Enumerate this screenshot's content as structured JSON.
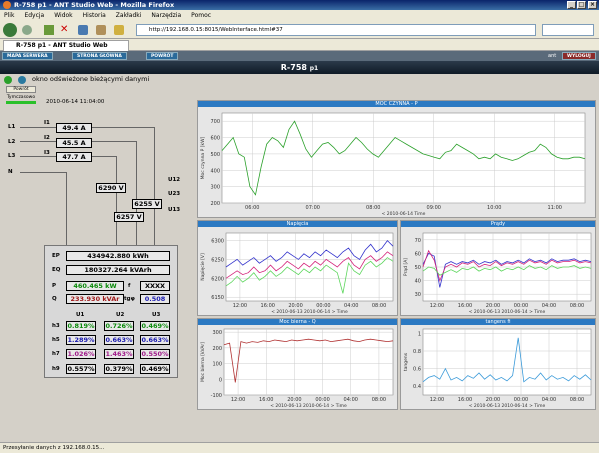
{
  "browser": {
    "title": "R-758 p1 - ANT Studio Web - Mozilla Firefox",
    "menu": [
      "Plik",
      "Edycja",
      "Widok",
      "Historia",
      "Zakładki",
      "Narzędzia",
      "Pomoc"
    ],
    "url": "http://192.168.0.15:8015/WebInterface.html#37",
    "tab_label": "R-758 p1 - ANT Studio Web",
    "status": "Przesyłanie danych z 192.168.0.15..."
  },
  "app": {
    "toolbar": [
      "MAPA SERWERA",
      "STRONA GŁÓWNA",
      "POWRÓT"
    ],
    "right_button": "WYLOGUJ",
    "user": "ant",
    "title_main": "R-758",
    "title_sub": "p1",
    "status_message": "okno odświeżone bieżącymi danymi",
    "btn_refresh": "Powrót",
    "btn_timeline": "Tymczasowo",
    "timestamp": "2010-06-14 11:04:00"
  },
  "panel": {
    "phases": [
      {
        "label": "L1",
        "sub": "I1",
        "value": "49.4 A"
      },
      {
        "label": "L2",
        "sub": "I2",
        "value": "45.5 A"
      },
      {
        "label": "L3",
        "sub": "I3",
        "value": "47.7 A"
      },
      {
        "label": "N"
      }
    ],
    "voltages": [
      {
        "label": "U12",
        "value": "6290 V"
      },
      {
        "label": "U23",
        "value": "6255 V"
      },
      {
        "label": "U13",
        "value": "6257 V"
      }
    ],
    "ep_label": "EP",
    "ep": "434942.880 kWh",
    "eq_label": "EQ",
    "eq": "180327.264 kVArh",
    "p_label": "P",
    "p": "460.465 kW",
    "f_label": "f",
    "f": "XXXX",
    "q_label": "Q",
    "q": "233.930 kVAr",
    "tgphi_label": "tgφ",
    "tgphi": "0.508",
    "harm_headers": [
      "U1",
      "U2",
      "U3"
    ],
    "harm_rows": [
      {
        "label": "h3",
        "values": [
          "0.819%",
          "0.726%",
          "0.469%"
        ],
        "color": "#0a8a0a"
      },
      {
        "label": "h5",
        "values": [
          "1.289%",
          "0.663%",
          "0.663%"
        ],
        "color": "#1a1ab0"
      },
      {
        "label": "h7",
        "values": [
          "1.026%",
          "1.463%",
          "0.550%"
        ],
        "color": "#a01a8a"
      },
      {
        "label": "h9",
        "values": [
          "0.557%",
          "0.379%",
          "0.469%"
        ],
        "color": "#000000"
      }
    ]
  },
  "chart_data": [
    {
      "type": "line",
      "title": "MOC CZYNNA - P",
      "ylabel": "Moc czynna P [kW]",
      "xlabel": "Time",
      "xnote": "< 2010-06-14",
      "x_ticks": [
        "06:00",
        "07:00",
        "08:00",
        "09:00",
        "10:00",
        "11:00"
      ],
      "y_ticks": [
        200,
        300,
        400,
        500,
        600,
        700
      ],
      "ylim": [
        200,
        750
      ],
      "series": [
        {
          "color": "#2aa02a",
          "values": [
            520,
            560,
            600,
            500,
            480,
            300,
            250,
            420,
            560,
            600,
            580,
            540,
            650,
            700,
            620,
            530,
            480,
            520,
            560,
            570,
            540,
            500,
            520,
            560,
            600,
            570,
            530,
            500,
            480,
            520,
            560,
            600,
            580,
            560,
            540,
            520,
            500,
            490,
            480,
            470,
            510,
            520,
            560,
            540,
            520,
            500,
            470,
            480,
            470,
            500,
            480,
            470,
            460,
            470,
            490,
            510,
            520,
            560,
            540,
            500,
            480,
            470,
            470,
            480,
            480,
            470
          ]
        }
      ]
    },
    {
      "type": "line",
      "title": "Napięcia",
      "ylabel": "Napięcie [V]",
      "xlabel": "Time",
      "xnote": "< 2010-06-13 2010-06-14 >",
      "x_ticks": [
        "12:00",
        "16:00",
        "20:00",
        "00:00",
        "04:00",
        "08:00"
      ],
      "y_ticks": [
        6150,
        6200,
        6250,
        6300
      ],
      "ylim": [
        6140,
        6320
      ],
      "series": [
        {
          "color": "#3333cc",
          "values": [
            6230,
            6240,
            6250,
            6235,
            6245,
            6255,
            6240,
            6250,
            6260,
            6245,
            6255,
            6270,
            6260,
            6250,
            6265,
            6255,
            6270,
            6260,
            6275,
            6265,
            6255,
            6270,
            6280,
            6260,
            6250,
            6275,
            6290,
            6270,
            6280,
            6300,
            6285
          ]
        },
        {
          "color": "#d4237a",
          "values": [
            6200,
            6210,
            6220,
            6210,
            6215,
            6230,
            6215,
            6220,
            6235,
            6220,
            6230,
            6245,
            6235,
            6225,
            6240,
            6230,
            6245,
            6235,
            6250,
            6240,
            6230,
            6245,
            6255,
            6235,
            6225,
            6250,
            6260,
            6245,
            6255,
            6270,
            6260
          ]
        },
        {
          "color": "#5cd65c",
          "values": [
            6180,
            6190,
            6205,
            6190,
            6200,
            6215,
            6195,
            6205,
            6220,
            6205,
            6215,
            6230,
            6220,
            6210,
            6225,
            6215,
            6230,
            6220,
            6235,
            6225,
            6215,
            6160,
            6240,
            6220,
            6210,
            6235,
            6245,
            6230,
            6240,
            6255,
            6245
          ]
        }
      ]
    },
    {
      "type": "line",
      "title": "Prądy",
      "ylabel": "Prąd [A]",
      "xlabel": "Time",
      "xnote": "< 2010-06-13 2010-06-14 >",
      "x_ticks": [
        "12:00",
        "16:00",
        "20:00",
        "00:00",
        "04:00",
        "08:00"
      ],
      "y_ticks": [
        30,
        40,
        50,
        60,
        70
      ],
      "ylim": [
        25,
        75
      ],
      "series": [
        {
          "color": "#3333cc",
          "values": [
            52,
            60,
            58,
            35,
            52,
            54,
            52,
            54,
            53,
            55,
            52,
            54,
            53,
            55,
            52,
            54,
            53,
            55,
            53,
            56,
            54,
            55,
            53,
            56,
            54,
            55,
            55,
            56,
            54,
            55,
            54
          ]
        },
        {
          "color": "#d4237a",
          "values": [
            50,
            62,
            55,
            40,
            50,
            52,
            50,
            53,
            52,
            54,
            50,
            52,
            51,
            54,
            51,
            53,
            52,
            54,
            52,
            55,
            53,
            54,
            52,
            55,
            53,
            54,
            54,
            55,
            53,
            54,
            53
          ]
        },
        {
          "color": "#5cd65c",
          "values": [
            47,
            50,
            49,
            44,
            46,
            48,
            46,
            49,
            48,
            50,
            47,
            49,
            48,
            50,
            47,
            49,
            48,
            50,
            48,
            51,
            49,
            50,
            48,
            51,
            49,
            50,
            50,
            51,
            49,
            50,
            49
          ]
        }
      ]
    },
    {
      "type": "line",
      "title": "Moc bierna - Q",
      "ylabel": "Moc bierna [kVAr]",
      "xlabel": "Time",
      "xnote": "< 2010-06-13 2010-06-14 >",
      "x_ticks": [
        "12:00",
        "16:00",
        "20:00",
        "00:00",
        "04:00",
        "08:00"
      ],
      "y_ticks": [
        -100,
        0,
        100,
        200,
        300
      ],
      "ylim": [
        -100,
        320
      ],
      "series": [
        {
          "color": "#b03030",
          "values": [
            220,
            230,
            -20,
            240,
            230,
            240,
            235,
            245,
            240,
            250,
            245,
            240,
            250,
            245,
            250,
            255,
            250,
            245,
            250,
            240,
            245,
            250,
            255,
            245,
            240,
            250,
            255,
            250,
            245,
            240,
            245
          ]
        }
      ]
    },
    {
      "type": "line",
      "title": "tangens fi",
      "ylabel": "tangens",
      "xlabel": "Time",
      "xnote": "< 2010-06-13 2010-06-14 >",
      "x_ticks": [
        "12:00",
        "16:00",
        "20:00",
        "00:00",
        "04:00",
        "08:00"
      ],
      "y_ticks": [
        0.4,
        0.6,
        0.8,
        1
      ],
      "ylim": [
        0.3,
        1.05
      ],
      "series": [
        {
          "color": "#3a9ad9",
          "values": [
            0.45,
            0.5,
            0.52,
            0.48,
            0.6,
            0.47,
            0.5,
            0.46,
            0.52,
            0.49,
            0.55,
            0.48,
            0.53,
            0.47,
            0.5,
            0.46,
            0.52,
            0.95,
            0.45,
            0.5,
            0.48,
            0.55,
            0.47,
            0.52,
            0.48,
            0.5,
            0.46,
            0.52,
            0.48,
            0.53,
            0.47
          ]
        }
      ]
    }
  ]
}
